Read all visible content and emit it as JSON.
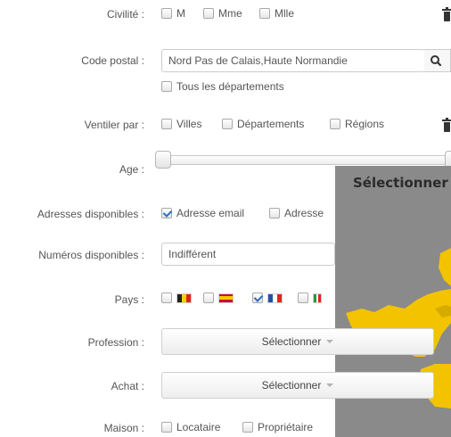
{
  "civilite": {
    "label": "Civilité :",
    "options": [
      "M",
      "Mme",
      "Mlle"
    ]
  },
  "code_postal": {
    "label": "Code postal :",
    "value": "Nord Pas de Calais,Haute Normandie",
    "all_depts": "Tous les départements"
  },
  "ventiler": {
    "label": "Ventiler par :",
    "options": [
      "Villes",
      "Départements",
      "Régions"
    ]
  },
  "age": {
    "label": "Age :"
  },
  "adresses": {
    "label": "Adresses disponibles :",
    "options": [
      "Adresse email",
      "Adresse"
    ],
    "email_checked": true
  },
  "numeros": {
    "label": "Numéros disponibles :",
    "value": "Indifférent"
  },
  "pays": {
    "label": "Pays :"
  },
  "profession": {
    "label": "Profession :",
    "button": "Sélectionner"
  },
  "achat": {
    "label": "Achat :",
    "button": "Sélectionner"
  },
  "maison": {
    "label": "Maison :",
    "options": [
      "Locataire",
      "Propriétaire"
    ]
  },
  "map_modal": {
    "title": "Sélectionner"
  },
  "colors": {
    "map_bg": "#8a8a8a",
    "region": "#f3c300",
    "check": "#2a6fbf"
  },
  "icons": [
    "trash-icon",
    "search-icon",
    "caret-down-icon"
  ]
}
